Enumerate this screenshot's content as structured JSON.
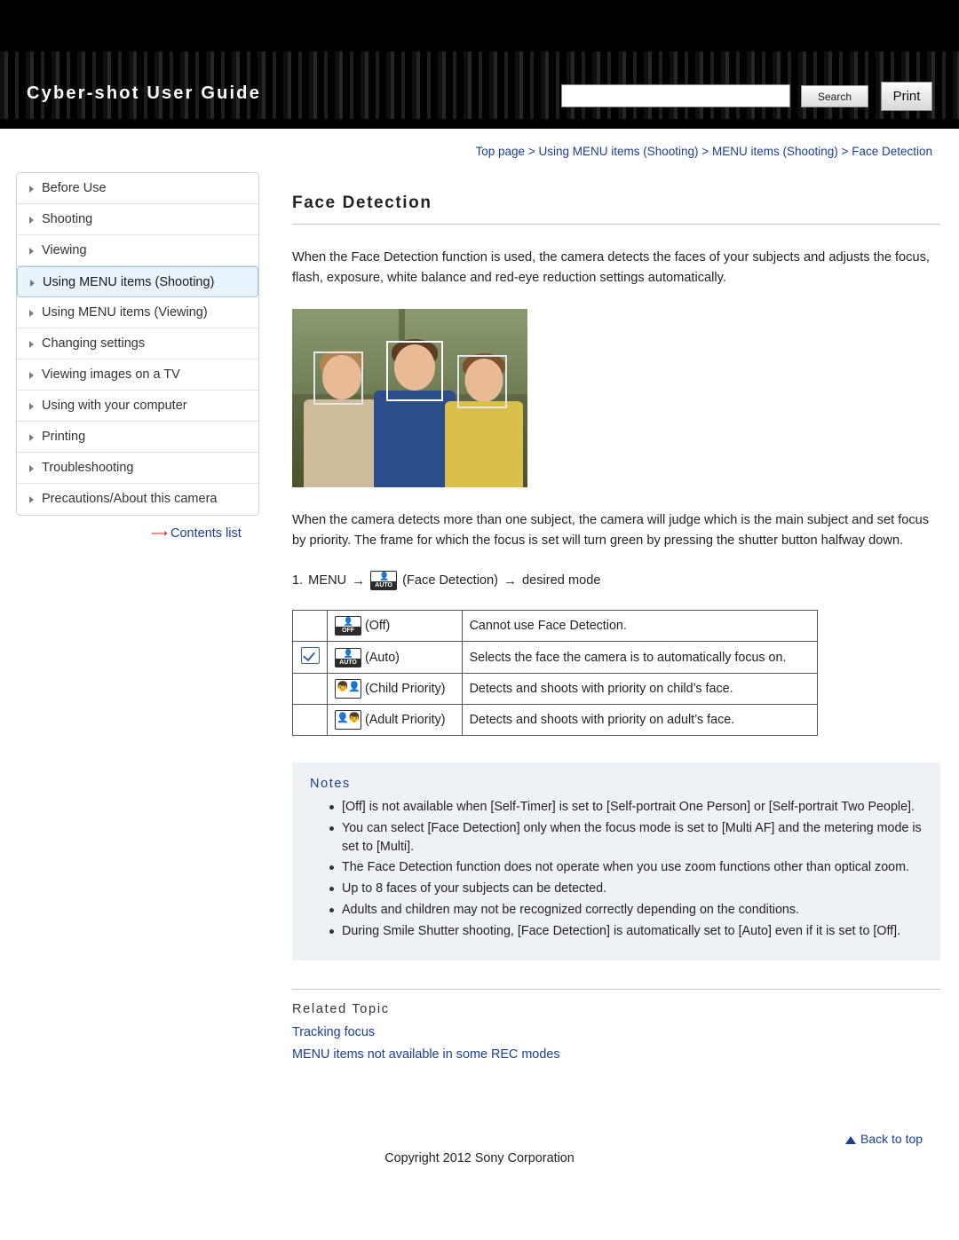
{
  "header": {
    "title": "Cyber-shot User Guide",
    "search_value": "",
    "search_placeholder": "",
    "search_label": "Search",
    "print_label": "Print"
  },
  "breadcrumb": {
    "items": [
      "Top page",
      "Using MENU items (Shooting)",
      "MENU items (Shooting)",
      "Face Detection"
    ],
    "separator": ">"
  },
  "sidebar": {
    "items": [
      {
        "label": "Before Use",
        "selected": false
      },
      {
        "label": "Shooting",
        "selected": false
      },
      {
        "label": "Viewing",
        "selected": false
      },
      {
        "label": "Using MENU items (Shooting)",
        "selected": true
      },
      {
        "label": "Using MENU items (Viewing)",
        "selected": false
      },
      {
        "label": "Changing settings",
        "selected": false
      },
      {
        "label": "Viewing images on a TV",
        "selected": false
      },
      {
        "label": "Using with your computer",
        "selected": false
      },
      {
        "label": "Printing",
        "selected": false
      },
      {
        "label": "Troubleshooting",
        "selected": false
      },
      {
        "label": "Precautions/About this camera",
        "selected": false
      }
    ],
    "contents_list": "Contents list"
  },
  "main": {
    "title": "Face Detection",
    "intro": "When the Face Detection function is used, the camera detects the faces of your subjects and adjusts the focus, flash, exposure, white balance and red-eye reduction settings automatically.",
    "paragraph2": "When the camera detects more than one subject, the camera will judge which is the main subject and set focus by priority. The frame for which the focus is set will turn green by pressing the shutter button halfway down.",
    "step": {
      "number": "1.",
      "menu": "MENU",
      "icon_label": "(Face Detection)",
      "result": "desired mode",
      "arrow": "→"
    },
    "table": {
      "rows": [
        {
          "checked": false,
          "icon_badge": "OFF",
          "icon_type": "badge",
          "label": "(Off)",
          "description": "Cannot use Face Detection."
        },
        {
          "checked": true,
          "icon_badge": "AUTO",
          "icon_type": "badge",
          "label": "(Auto)",
          "description": "Selects the face the camera is to automatically focus on."
        },
        {
          "checked": false,
          "icon_badge": "",
          "icon_type": "child",
          "label": "(Child Priority)",
          "description": "Detects and shoots with priority on child’s face."
        },
        {
          "checked": false,
          "icon_badge": "",
          "icon_type": "adult",
          "label": "(Adult Priority)",
          "description": "Detects and shoots with priority on adult’s face."
        }
      ]
    },
    "notes": {
      "title": "Notes",
      "items": [
        "[Off] is not available when [Self-Timer] is set to [Self-portrait One Person] or [Self-portrait Two People].",
        "You can select [Face Detection] only when the focus mode is set to [Multi AF] and the metering mode is set to [Multi].",
        "The Face Detection function does not operate when you use zoom functions other than optical zoom.",
        "Up to 8 faces of your subjects can be detected.",
        "Adults and children may not be recognized correctly depending on the conditions.",
        "During Smile Shutter shooting, [Face Detection] is automatically set to [Auto] even if it is set to [Off]."
      ]
    },
    "related": {
      "title": "Related Topic",
      "links": [
        "Tracking focus",
        "MENU items not available in some REC modes"
      ]
    }
  },
  "footer": {
    "back_to_top": "Back to top",
    "copyright": "Copyright 2012 Sony Corporation"
  },
  "colors": {
    "link": "#1b3f94",
    "selected_bg": "#e9f3fb",
    "notes_bg": "#eef2f7"
  }
}
